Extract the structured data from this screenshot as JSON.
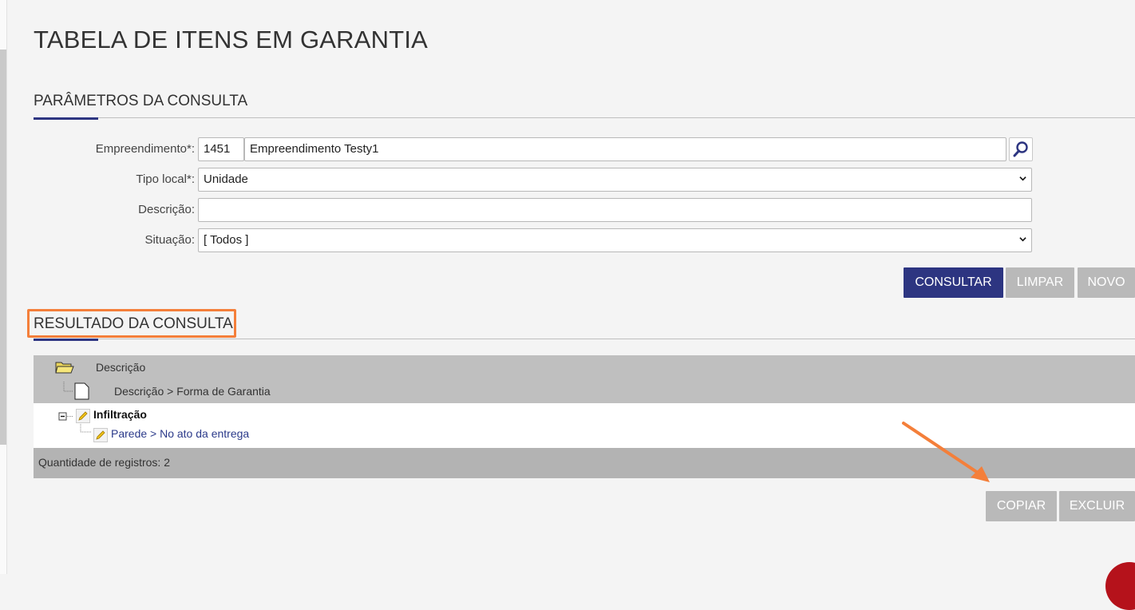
{
  "page": {
    "title": "TABELA DE ITENS EM GARANTIA"
  },
  "params": {
    "section_title": "PARÂMETROS DA CONSULTA",
    "empreendimento": {
      "label": "Empreendimento*:",
      "code": "1451",
      "name": "Empreendimento Testy1"
    },
    "tipo_local": {
      "label": "Tipo local*:",
      "value": "Unidade"
    },
    "descricao": {
      "label": "Descrição:",
      "value": ""
    },
    "situacao": {
      "label": "Situação:",
      "value": "[ Todos ]"
    },
    "buttons": {
      "consultar": "CONSULTAR",
      "limpar": "LIMPAR",
      "novo": "NOVO"
    }
  },
  "results": {
    "section_title": "RESULTADO DA CONSULTA",
    "header": {
      "level1": "Descrição",
      "level2": "Descrição > Forma de Garantia"
    },
    "tree": {
      "root": {
        "label": "Infiltração",
        "expanded": true
      },
      "child": {
        "label": "Parede > No ato da entrega"
      }
    },
    "footer": "Quantidade de registros: 2",
    "buttons": {
      "copiar": "COPIAR",
      "excluir": "EXCLUIR"
    }
  },
  "colors": {
    "primary": "#2d3581",
    "accent_highlight": "#f47f3a",
    "button_grey": "#b9b9b9",
    "link": "#2b3a8a"
  },
  "icons": [
    "search-icon",
    "chevron-down-icon",
    "folder-icon",
    "document-icon",
    "pencil-icon",
    "collapse-icon"
  ]
}
